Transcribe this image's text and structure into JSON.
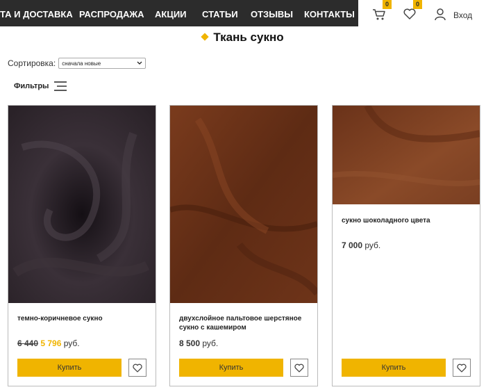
{
  "nav": {
    "items": [
      {
        "label": "та и доставка"
      },
      {
        "label": "Распродажа"
      },
      {
        "label": "Акции"
      },
      {
        "label": "Статьи"
      },
      {
        "label": "Отзывы"
      },
      {
        "label": "Контакты"
      }
    ]
  },
  "header": {
    "cart_count": "0",
    "wishlist_count": "0",
    "login_label": "Вход",
    "badge_color": "#f0b400",
    "icons": [
      "cart-icon",
      "heart-icon",
      "user-icon"
    ]
  },
  "page": {
    "title": "Ткань сукно"
  },
  "sort": {
    "label": "Сортировка:",
    "selected": "сначала новые"
  },
  "filters": {
    "label": "Фильтры"
  },
  "products": [
    {
      "title": "темно-коричневое сукно",
      "old_price": "6 440",
      "price": "5 796",
      "currency": "руб.",
      "buy_label": "Купить",
      "image_color": "#2a2228"
    },
    {
      "title": "двухслойное пальтовое шерстяное сукно с кашемиром",
      "old_price": "",
      "price": "8 500",
      "currency": "руб.",
      "buy_label": "Купить",
      "image_color": "#6b3218"
    },
    {
      "title": "сукно шоколадного цвета",
      "old_price": "",
      "price": "7 000",
      "currency": "руб.",
      "buy_label": "Купить",
      "image_color": "#7a3f22"
    }
  ]
}
